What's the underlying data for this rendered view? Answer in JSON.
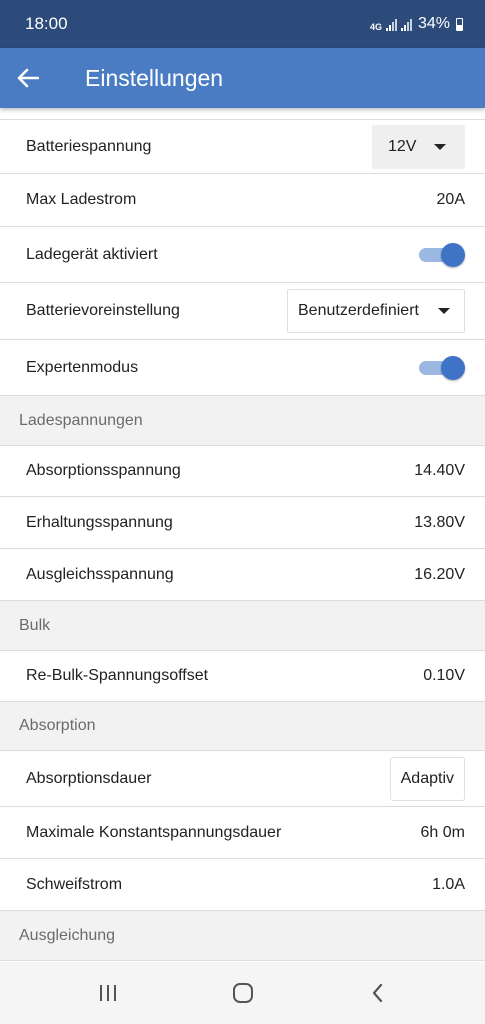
{
  "status_bar": {
    "time": "18:00",
    "network": "4G",
    "battery_percent": "34%"
  },
  "app_bar": {
    "title": "Einstellungen",
    "back_icon": "arrow-left-icon"
  },
  "settings": {
    "battery_voltage": {
      "label": "Batteriespannung",
      "value": "12V"
    },
    "max_charge_current": {
      "label": "Max Ladestrom",
      "value": "20A"
    },
    "charger_enabled": {
      "label": "Ladegerät aktiviert",
      "on": true
    },
    "battery_preset": {
      "label": "Batterievoreinstellung",
      "value": "Benutzerdefiniert"
    },
    "expert_mode": {
      "label": "Expertenmodus",
      "on": true
    }
  },
  "sections": {
    "charge_voltages": {
      "title": "Ladespannungen",
      "absorption_voltage": {
        "label": "Absorptionsspannung",
        "value": "14.40V"
      },
      "float_voltage": {
        "label": "Erhaltungsspannung",
        "value": "13.80V"
      },
      "equalization_voltage": {
        "label": "Ausgleichsspannung",
        "value": "16.20V"
      }
    },
    "bulk": {
      "title": "Bulk",
      "rebulk_offset": {
        "label": "Re-Bulk-Spannungsoffset",
        "value": "0.10V"
      }
    },
    "absorption": {
      "title": "Absorption",
      "duration": {
        "label": "Absorptionsdauer",
        "value": "Adaptiv"
      },
      "max_duration": {
        "label": "Maximale Konstantspannungsdauer",
        "value": "6h 0m"
      },
      "tail_current": {
        "label": "Schweifstrom",
        "value": "1.0A"
      }
    },
    "equalization": {
      "title": "Ausgleichung"
    }
  },
  "nav_bar": {
    "icons": [
      "recent-apps-icon",
      "home-icon",
      "back-icon"
    ]
  },
  "colors": {
    "status_bar": "#2c4a7a",
    "app_bar": "#4a7cc4",
    "toggle_on": "#3f73c6"
  }
}
